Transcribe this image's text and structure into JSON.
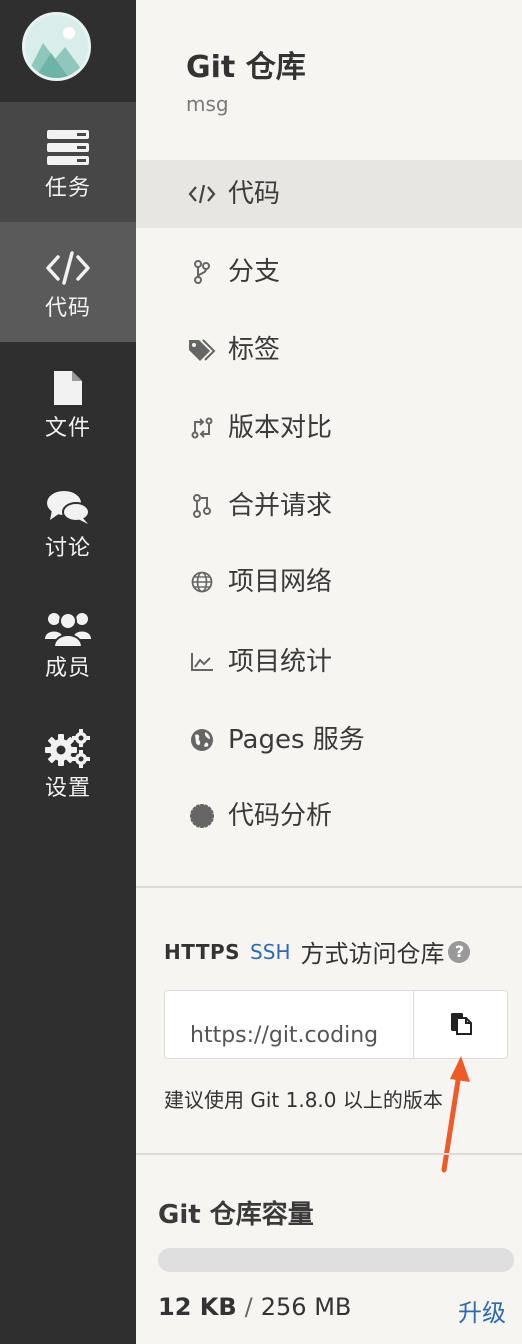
{
  "sidebar": {
    "items": [
      {
        "name": "tasks",
        "label": "任务",
        "icon": "list-icon"
      },
      {
        "name": "code",
        "label": "代码",
        "icon": "code-icon"
      },
      {
        "name": "files",
        "label": "文件",
        "icon": "file-icon"
      },
      {
        "name": "discuss",
        "label": "讨论",
        "icon": "chat-icon"
      },
      {
        "name": "members",
        "label": "成员",
        "icon": "users-icon"
      },
      {
        "name": "settings",
        "label": "设置",
        "icon": "gears-icon"
      }
    ],
    "active": "code"
  },
  "repo": {
    "title": "Git 仓库",
    "subtitle": "msg"
  },
  "menu": {
    "items": [
      {
        "label": "代码",
        "icon": "code-icon"
      },
      {
        "label": "分支",
        "icon": "branch-icon"
      },
      {
        "label": "标签",
        "icon": "tags-icon"
      },
      {
        "label": "版本对比",
        "icon": "compare-icon"
      },
      {
        "label": "合并请求",
        "icon": "merge-request-icon"
      },
      {
        "label": "项目网络",
        "icon": "globe-icon"
      },
      {
        "label": "项目统计",
        "icon": "chart-icon"
      },
      {
        "label": "Pages 服务",
        "icon": "earth-icon"
      },
      {
        "label": "代码分析",
        "icon": "gear-badge-icon"
      }
    ],
    "active": "代码"
  },
  "access": {
    "https_label": "HTTPS",
    "ssh_label": "SSH",
    "text": "方式访问仓库",
    "help": "?",
    "url_value": "https://git.coding",
    "tip": "建议使用 Git 1.8.0 以上的版本"
  },
  "capacity": {
    "title": "Git 仓库容量",
    "used": "12 KB",
    "separator": "/",
    "total": "256 MB",
    "fraction": 5e-05,
    "upgrade": "升级"
  },
  "colors": {
    "sidebar_bg": "#2f2f2f",
    "link": "#2e6ab3",
    "arrow": "#f05a28"
  }
}
